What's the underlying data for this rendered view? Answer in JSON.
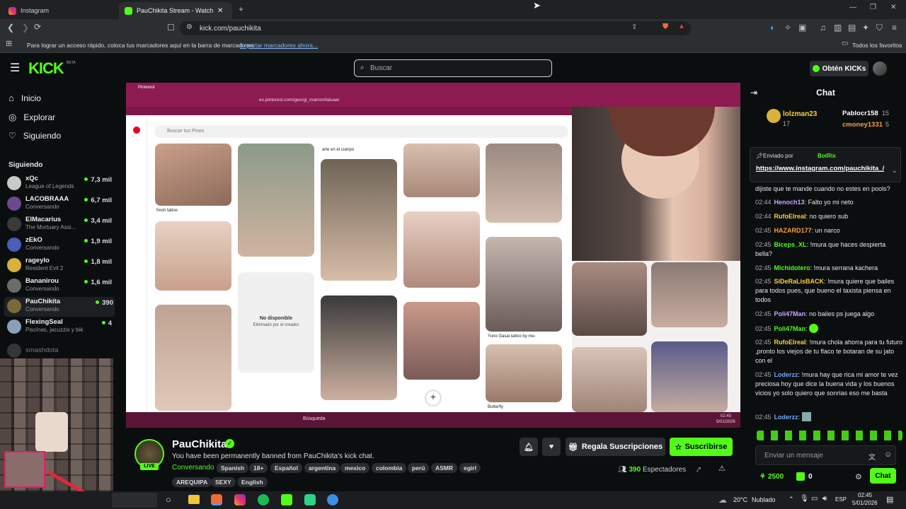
{
  "browser": {
    "tabs": [
      {
        "label": "Instagram"
      },
      {
        "label": "PauChikita Stream - Watch Li..."
      }
    ],
    "url": "kick.com/pauchikita",
    "bookmarks_msg": "Para lograr un acceso rápido, coloca tus marcadores aquí en la barra de marcadores.",
    "bookmarks_link": "Importar marcadores ahora...",
    "all_favorites": "Todos los favoritos"
  },
  "header": {
    "logo": "KICK",
    "beta": "BETA",
    "search_placeholder": "Buscar",
    "get_kicks": "Obtén KICKs"
  },
  "sidebar": {
    "nav": [
      {
        "label": "Inicio",
        "icon": "home-icon"
      },
      {
        "label": "Explorar",
        "icon": "compass-icon"
      },
      {
        "label": "Siguiendo",
        "icon": "heart-icon"
      }
    ],
    "following_title": "Siguiendo",
    "following": [
      {
        "name": "xQc",
        "category": "League of Legends",
        "viewers": "7,3 mil",
        "color": "#c9c9c9"
      },
      {
        "name": "LACOBRAAA",
        "category": "Conversando",
        "viewers": "6,7 mil",
        "color": "#6a4a8a"
      },
      {
        "name": "ElMacarius",
        "category": "The Mortuary Assi...",
        "viewers": "3,4 mil",
        "color": "#3a3a3a"
      },
      {
        "name": "zEkO",
        "category": "Conversando",
        "viewers": "1,9 mil",
        "color": "#4b5db8"
      },
      {
        "name": "rageylo",
        "category": "Resident Evil 2",
        "viewers": "1,8 mil",
        "color": "#d8b23a"
      },
      {
        "name": "Bananirou",
        "category": "Conversando",
        "viewers": "1,6 mil",
        "color": "#6b6b6b"
      },
      {
        "name": "PauChikita",
        "category": "Conversando",
        "viewers": "390",
        "color": "#7a6a3a"
      },
      {
        "name": "FlexingSeal",
        "category": "Piscinas, jacuzzis y bikinis",
        "viewers": "4",
        "color": "#8aa0b8"
      }
    ],
    "offline": "smashdota"
  },
  "stream": {
    "inner_url": "es.pinterest.com/georgi_marron/tatuaa/",
    "inner_search": "Buscar tus Pines",
    "pin_caption_1": "arte en el cuerpo",
    "pin_caption_2": "fresh tattoo",
    "not_available": "No disponible",
    "removed": "Eliminado por el creador",
    "pin_caption_3": "Yuno Gasai tattoo by me-",
    "pin_caption_4": "Butterfly",
    "taskbar_search": "Búsqueda",
    "inner_time": "02:45",
    "inner_date": "5/01/2026"
  },
  "channel": {
    "name": "PauChikita",
    "live": "LIVE",
    "ban_message": "You have been permanently banned from PauChikita's kick chat.",
    "category": "Conversando",
    "tags": [
      "Spanish",
      "18+",
      "Español",
      "argentina",
      "mexico",
      "colombia",
      "perú",
      "ASMR",
      "egirl",
      "AREQUIPA",
      "SEXY",
      "English"
    ],
    "gift_subs": "Regala Suscripciones",
    "subscribe": "Suscribirse",
    "viewers": "390",
    "viewers_label": "Espectadores",
    "accent": "#53fc18"
  },
  "chat": {
    "title": "Chat",
    "gifters": [
      {
        "name": "lolzman23",
        "count": "17"
      },
      {
        "name": "Pablocr158",
        "count": "15"
      },
      {
        "name": "cmoney1331",
        "count": "5"
      }
    ],
    "pinned_by": "Enviado por",
    "pinned_user": "BotRix",
    "pinned_link": "https://www.instagram.com/pauchikita_/",
    "messages": [
      {
        "time": "",
        "user": "",
        "color": "#e8e8e8",
        "text": "dijiste que te mande cuando no estes en pools?"
      },
      {
        "time": "02:44",
        "user": "Henoch13",
        "color": "#c9a4ff",
        "text": "Falto yo mi neto"
      },
      {
        "time": "02:44",
        "user": "RufoElreal",
        "color": "#ffcf3a",
        "text": "no quiero sub"
      },
      {
        "time": "02:45",
        "user": "HAZARD177",
        "color": "#ff9c3a",
        "text": "un narco"
      },
      {
        "time": "02:45",
        "user": "Biceps_XL",
        "color": "#53fc18",
        "text": "!mura que haces despierta bella?"
      },
      {
        "time": "02:45",
        "user": "Michidotero",
        "color": "#53fc18",
        "text": "!mura serrana kachera"
      },
      {
        "time": "02:45",
        "user": "SiDeRaLisBACK",
        "color": "#ffcf3a",
        "text": "!mura quiere que bailes para todos pues, que bueno el taxista piensa en todos"
      },
      {
        "time": "02:45",
        "user": "Poli47Man",
        "color": "#c9a4ff",
        "text": "no bailes ps juega algo"
      },
      {
        "time": "02:45",
        "user": "Poli47Man",
        "color": "#53fc18",
        "text": ""
      },
      {
        "time": "02:45",
        "user": "RufoElreal",
        "color": "#ffcf3a",
        "text": "!mura chola ahorra para tu futuro ,pronto los viejos de tu flaco te botaran de su jato con el"
      },
      {
        "time": "02:45",
        "user": "Loderzz",
        "color": "#6fa8ff",
        "text": "!mura hay que rica mi amor te vez preciosa hoy que dice la buena vida y los buenos vicios yo solo quiero que sonrias eso me basta"
      },
      {
        "time": "02:45",
        "user": "Loderzz",
        "color": "#6fa8ff",
        "text": ""
      }
    ],
    "input_placeholder": "Enviar un mensaje",
    "points": "2500",
    "kicks": "0",
    "send": "Chat"
  },
  "taskbar": {
    "weather": "20°C",
    "weather_label": "Nublado",
    "lang": "ESP",
    "time": "02:45",
    "date": "5/01/2026"
  }
}
